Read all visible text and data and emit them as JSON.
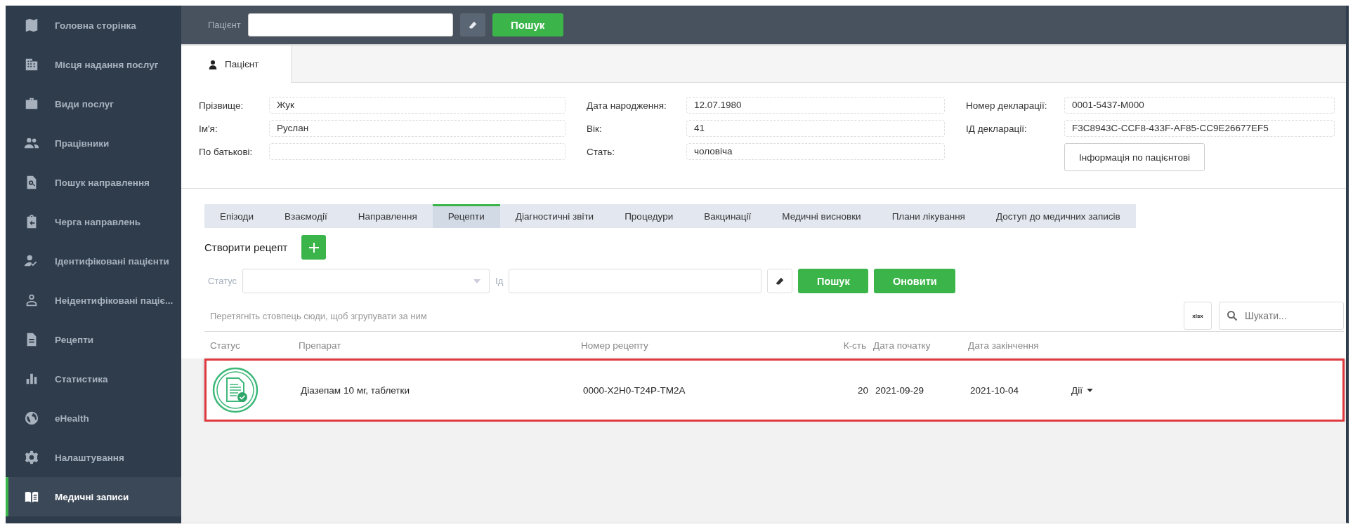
{
  "sidebar": {
    "items": [
      {
        "label": "Головна сторінка",
        "selected": false
      },
      {
        "label": "Місця надання послуг",
        "selected": false
      },
      {
        "label": "Види послуг",
        "selected": false
      },
      {
        "label": "Працівники",
        "selected": false
      },
      {
        "label": "Пошук направлення",
        "selected": false
      },
      {
        "label": "Черга направлень",
        "selected": false
      },
      {
        "label": "Ідентифіковані пацієнти",
        "selected": false
      },
      {
        "label": "Неідентифіковані паціє...",
        "selected": false
      },
      {
        "label": "Рецепти",
        "selected": false
      },
      {
        "label": "Статистика",
        "selected": false
      },
      {
        "label": "eHealth",
        "selected": false
      },
      {
        "label": "Налаштування",
        "selected": false
      },
      {
        "label": "Медичні записи",
        "selected": true
      }
    ]
  },
  "top_bar": {
    "patient_label": "Пацієнт",
    "search_button": "Пошук"
  },
  "patient_tab": {
    "label": "Пацієнт",
    "selected": true
  },
  "patient_columns": [
    [
      {
        "label": "Прізвище:",
        "value": "Жук"
      },
      {
        "label": "Ім'я:",
        "value": "Руслан"
      },
      {
        "label": "По батькові:"
      }
    ],
    [
      {
        "label": "Дата народження:",
        "value": "12.07.1980"
      },
      {
        "label": "Вік:",
        "value": "41"
      },
      {
        "label": "Стать:",
        "value": "чоловіча"
      }
    ],
    [
      {
        "label": "Номер декларації:",
        "value": "0001-5437-M000"
      },
      {
        "label": "ІД декларації:",
        "value": "F3C8943C-CCF8-433F-AF85-CC9E26677EF5"
      }
    ]
  ],
  "patient_info_button": "Інформація по пацієнтові",
  "record_tabs": [
    {
      "label": "Епізоди",
      "selected": false
    },
    {
      "label": "Взаємодії",
      "selected": false
    },
    {
      "label": "Направлення",
      "selected": false
    },
    {
      "label": "Рецепти",
      "selected": true
    },
    {
      "label": "Діагностичні звіти",
      "selected": false
    },
    {
      "label": "Процедури",
      "selected": false
    },
    {
      "label": "Вакцинації",
      "selected": false
    },
    {
      "label": "Медичні висновки",
      "selected": false
    },
    {
      "label": "Плани лікування",
      "selected": false
    },
    {
      "label": "Доступ до медичних записів",
      "selected": false
    }
  ],
  "create_label": "Створити рецепт",
  "filters": {
    "status_label": "Статус",
    "id_label": "Ід",
    "search_button": "Пошук",
    "refresh_button": "Оновити"
  },
  "group_hint": "Перетягніть стовпець сюди, щоб згрупувати за ним",
  "export_button": "xlsx",
  "search": {
    "placeholder": "Шукати..."
  },
  "table": {
    "columns": [
      "Статус",
      "Препарат",
      "Номер рецепту",
      "К-сть",
      "Дата початку",
      "Дата закінчення"
    ],
    "rows": [
      {
        "drug": "Діазепам 10 мг, таблетки",
        "number": "0000-X2H0-T24P-TM2A",
        "quantity": "20",
        "start": "2021-09-29",
        "end": "2021-10-04",
        "actions": "Дії"
      }
    ]
  }
}
